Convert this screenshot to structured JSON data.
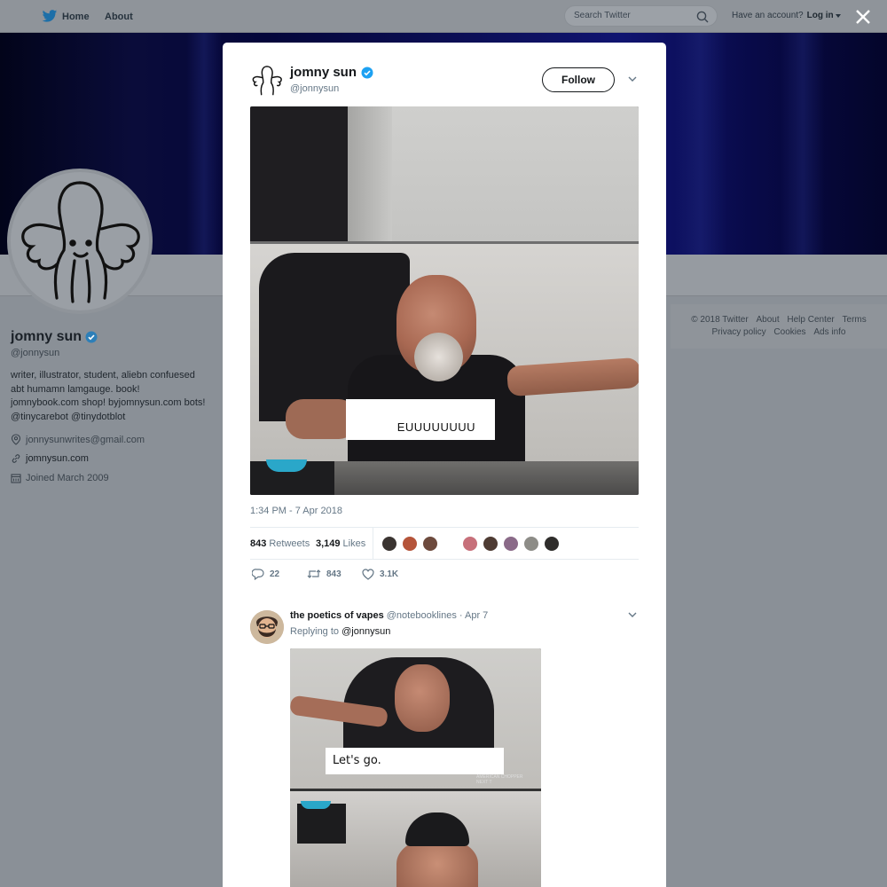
{
  "topnav": {
    "home_label": "Home",
    "about_label": "About",
    "search_placeholder": "Search Twitter",
    "have_account": "Have an account?",
    "login_label": "Log in"
  },
  "profile": {
    "name": "jomny sun",
    "handle": "@jonnysun",
    "bio_lines": [
      "writer, illustrator, student, aliebn confuesed",
      "abt humamn lamgauge. book!",
      "jomnybook.com shop! byjomnysun.com bots!",
      "@tinycarebot @tinydotblot"
    ],
    "email": "jonnysunwrites@gmail.com",
    "website": "jomnysun.com",
    "joined": "Joined March 2009"
  },
  "footer": {
    "row1": [
      "© 2018 Twitter",
      "About",
      "Help Center",
      "Terms"
    ],
    "row2": [
      "Privacy policy",
      "Cookies",
      "Ads info"
    ]
  },
  "tweet": {
    "name": "jomny sun",
    "handle": "@jonnysun",
    "follow_label": "Follow",
    "image_caption": "EUUUUUUUU",
    "timestamp": "1:34 PM - 7 Apr 2018",
    "retweets_count": "843",
    "retweets_label": "Retweets",
    "likes_count": "3,149",
    "likes_label": "Likes",
    "reply_count": "22",
    "retweet_count": "843",
    "like_count": "3.1K"
  },
  "reply": {
    "name": "the poetics of vapes",
    "handle": "@notebooklines",
    "date": "· Apr 7",
    "replying_prefix": "Replying to",
    "replying_to": "@jonnysun",
    "image_caption": "Let's go.",
    "image_logo_line1": "AMERICAN CHOPPER",
    "image_logo_line2": "NEXT T"
  },
  "colors": {
    "verified": "#1da1f2",
    "overlay_bg": "#8a9097",
    "banner": "#0b0e52"
  }
}
